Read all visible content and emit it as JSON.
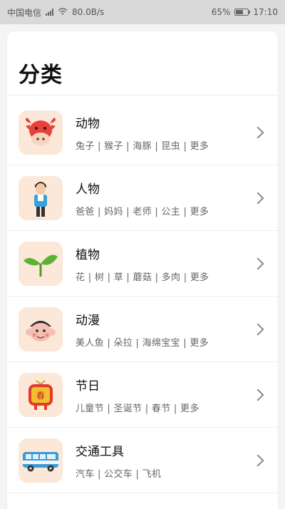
{
  "status_bar": {
    "carrier": "中国电信",
    "net_speed": "80.0B/s",
    "battery": "65%",
    "battery_level": 0.65,
    "time": "17:10"
  },
  "page": {
    "title": "分类"
  },
  "categories": [
    {
      "title": "动物",
      "subtitle": "兔子 | 猴子 | 海豚 | 昆虫 | 更多",
      "icon": "cow-icon"
    },
    {
      "title": "人物",
      "subtitle": "爸爸 | 妈妈 | 老师 | 公主 | 更多",
      "icon": "person-icon"
    },
    {
      "title": "植物",
      "subtitle": "花 | 树 | 草 | 蘑菇 | 多肉 | 更多",
      "icon": "sprout-icon"
    },
    {
      "title": "动漫",
      "subtitle": "美人鱼 | 朵拉 | 海绵宝宝 | 更多",
      "icon": "cartoon-face-icon"
    },
    {
      "title": "节日",
      "subtitle": "儿童节 | 圣诞节 | 春节 | 更多",
      "icon": "lantern-icon",
      "icon_text": "春"
    },
    {
      "title": "交通工具",
      "subtitle": "汽车 | 公交车 | 飞机",
      "icon": "bus-icon"
    }
  ]
}
